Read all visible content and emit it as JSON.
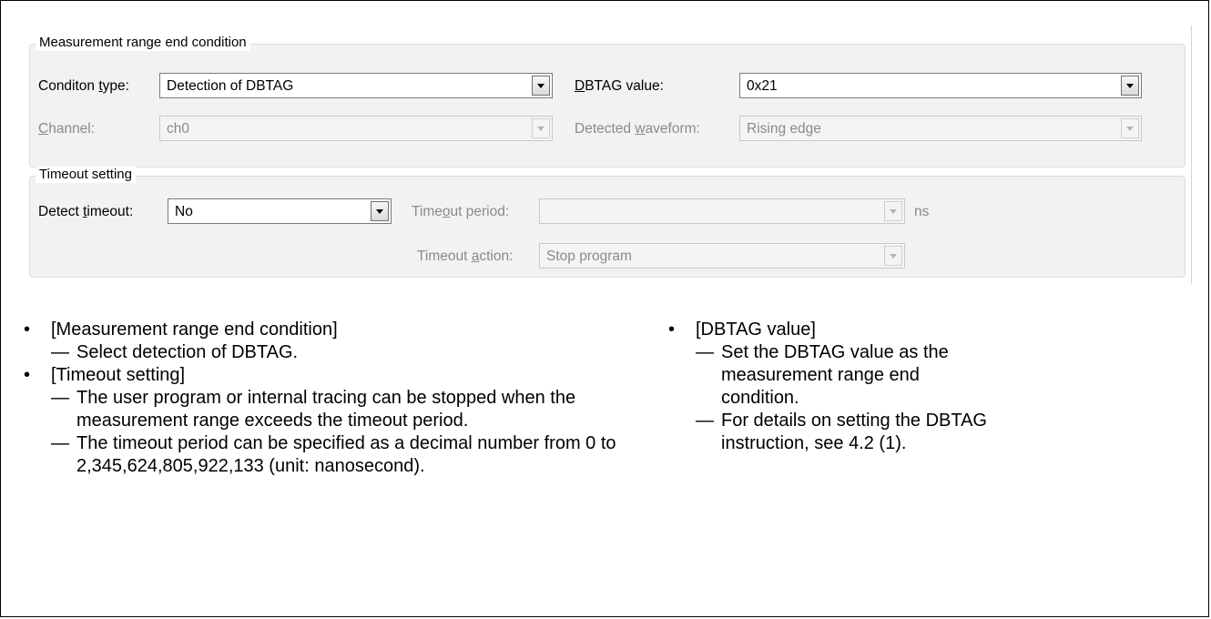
{
  "dialog": {
    "end_condition_group": {
      "legend": "Measurement range end condition",
      "condition_type": {
        "label_pre": "Conditon ",
        "label_key": "t",
        "label_post": "ype:",
        "value": "Detection of DBTAG"
      },
      "dbtag_value": {
        "label_pre": "",
        "label_key": "D",
        "label_post": "BTAG value:",
        "value": "0x21"
      },
      "channel": {
        "label_pre": "",
        "label_key": "C",
        "label_post": "hannel:",
        "value": "ch0"
      },
      "detected_waveform": {
        "label_pre": "Detected ",
        "label_key": "w",
        "label_post": "aveform:",
        "value": "Rising edge"
      }
    },
    "timeout_group": {
      "legend": "Timeout setting",
      "detect_timeout": {
        "label_pre": "Detect ",
        "label_key": "t",
        "label_post": "imeout:",
        "value": "No"
      },
      "timeout_period": {
        "label_pre": "Time",
        "label_key": "o",
        "label_post": "ut period:",
        "value": "",
        "unit": "ns"
      },
      "timeout_action": {
        "label_pre": "Timeout ",
        "label_key": "a",
        "label_post": "ction:",
        "value": "Stop program"
      }
    }
  },
  "notes_left": [
    {
      "title": "[Measurement range end condition]",
      "subs": [
        "Select detection of DBTAG."
      ]
    },
    {
      "title": "[Timeout setting]",
      "subs": [
        "The user program or internal tracing can be stopped when the measurement range exceeds the timeout period.",
        "The timeout period can be specified as a decimal number from 0 to 2,345,624,805,922,133 (unit: nanosecond)."
      ]
    }
  ],
  "notes_right": [
    {
      "title": "[DBTAG value]",
      "subs": [
        "Set the DBTAG value as the measurement range end condition.",
        "For details on setting the DBTAG instruction, see 4.2 (1)."
      ]
    }
  ],
  "symbols": {
    "bullet": "•",
    "dash": "—"
  }
}
